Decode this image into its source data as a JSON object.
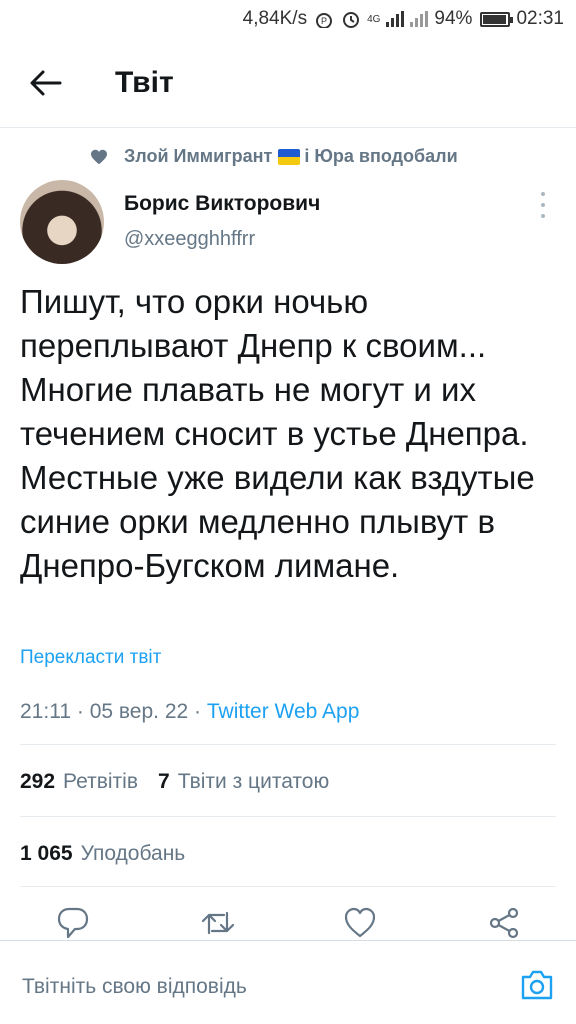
{
  "status_bar": {
    "speed": "4,84K/s",
    "network": "4G",
    "battery": "94%",
    "battery_level": 0.94,
    "time": "02:31"
  },
  "header": {
    "title": "Твіт",
    "back_icon": "arrow-left-icon"
  },
  "liked_by": {
    "user1": "Злой Иммигрант",
    "flag_icon": "ukraine-flag-emoji",
    "suffix": "і Юра вподобали"
  },
  "author": {
    "name": "Борис Викторович",
    "handle": "@xxeegghhffrr"
  },
  "tweet": {
    "text": "Пишут, что орки ночью переплывают Днепр к своим... Многие плавать не могут и их течением сносит в устье Днепра. Местные уже видели как вздутые синие орки медленно плывут в Днепро-Бугском лимане.",
    "translate_label": "Перекласти твіт",
    "time": "21:11",
    "date": "05 вер. 22",
    "separator": "·",
    "source": "Twitter Web App"
  },
  "stats": {
    "retweets_count": "292",
    "retweets_label": "Ретвітів",
    "quotes_count": "7",
    "quotes_label": "Твіти з цитатою",
    "likes_count": "1 065",
    "likes_label": "Уподобань"
  },
  "actions": [
    "reply-icon",
    "retweet-icon",
    "like-icon",
    "share-icon"
  ],
  "reply_bar": {
    "placeholder": "Твітніть свою відповідь",
    "camera_icon": "camera-icon"
  },
  "colors": {
    "accent": "#1da1f2",
    "secondary_text": "#657786",
    "primary_text": "#14171a",
    "divider": "#e6ecf0"
  }
}
